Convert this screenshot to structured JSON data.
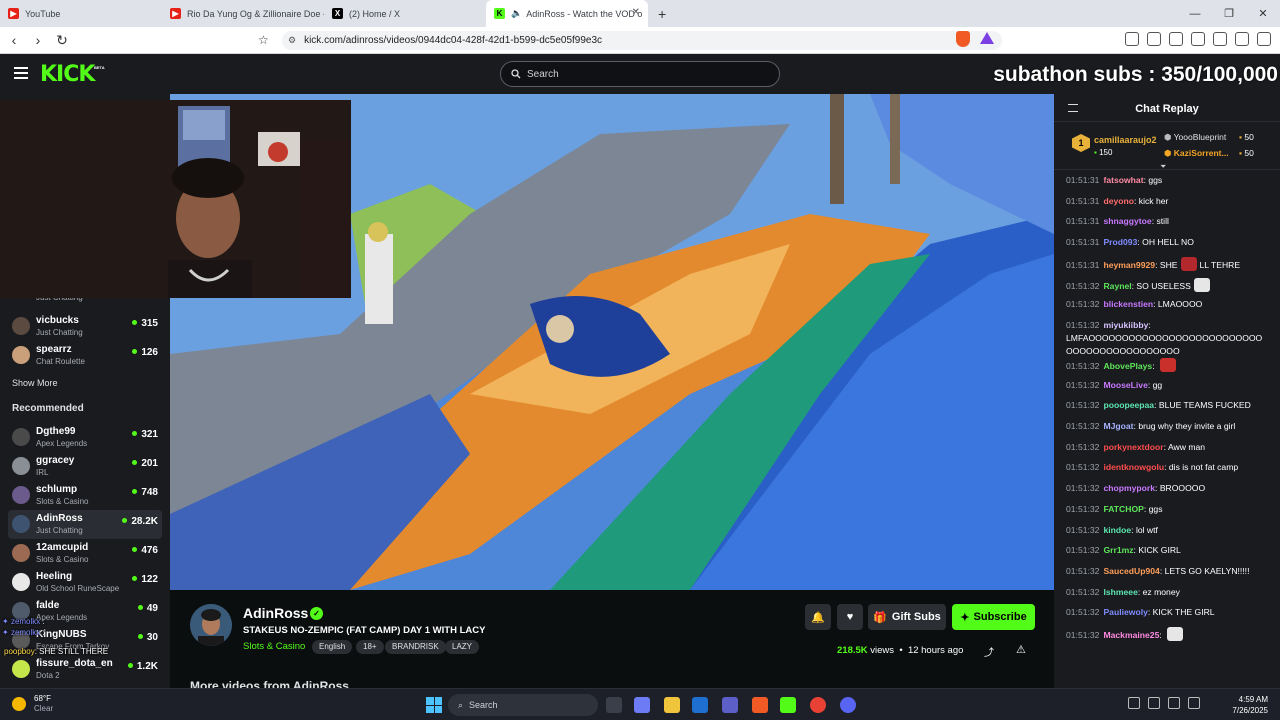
{
  "browser": {
    "tabs": [
      {
        "title": "YouTube",
        "icon": "youtube-icon",
        "color": "#e62117",
        "active": false
      },
      {
        "title": "Rio Da Yung Og & Zillionaire Doe - V",
        "icon": "youtube-icon",
        "color": "#e62117",
        "active": false
      },
      {
        "title": "(2) Home / X",
        "icon": "x-icon",
        "color": "#000000",
        "active": false
      },
      {
        "title": "AdinRoss - Watch the VOD o",
        "icon": "kick-icon",
        "color": "#53fc18",
        "active": true
      }
    ],
    "url": "kick.com/adinross/videos/0944dc04-428f-42d1-b599-dc5e05f99e3c"
  },
  "header": {
    "logo": "KICK",
    "logo_badge": "BETA",
    "search_placeholder": "Search",
    "overlay_banner": "subathon subs : 350/100,000"
  },
  "sidebar": {
    "following_partial_category": "Just Chatting",
    "following": [
      {
        "name": "vicbucks",
        "category": "Just Chatting",
        "viewers": "315",
        "avatar_color": "#5b4a3f"
      },
      {
        "name": "spearrz",
        "category": "Chat Roulette",
        "viewers": "126",
        "avatar_color": "#c9a079"
      }
    ],
    "show_more": "Show More",
    "recommended_title": "Recommended",
    "recommended": [
      {
        "name": "Dgthe99",
        "category": "Apex Legends",
        "viewers": "321",
        "avatar_color": "#4a4a4a",
        "selected": false
      },
      {
        "name": "ggracey",
        "category": "IRL",
        "viewers": "201",
        "avatar_color": "#8a8f96",
        "selected": false
      },
      {
        "name": "schlump",
        "category": "Slots & Casino",
        "viewers": "748",
        "avatar_color": "#6b5a8c",
        "selected": false
      },
      {
        "name": "AdinRoss",
        "category": "Just Chatting",
        "viewers": "28.2K",
        "avatar_color": "#3d5370",
        "selected": true
      },
      {
        "name": "12amcupid",
        "category": "Slots & Casino",
        "viewers": "476",
        "avatar_color": "#9c6a52",
        "selected": false
      },
      {
        "name": "Heeling",
        "category": "Old School RuneScape",
        "viewers": "122",
        "avatar_color": "#e8e8e8",
        "selected": false
      },
      {
        "name": "falde",
        "category": "Apex Legends",
        "viewers": "49",
        "avatar_color": "#4f5a6b",
        "selected": false
      },
      {
        "name": "KingNUBS",
        "category": "Escape From Tarkov",
        "viewers": "30",
        "avatar_color": "#5a5a5a",
        "selected": false
      },
      {
        "name": "fissure_dota_en",
        "category": "Dota 2",
        "viewers": "1.2K",
        "avatar_color": "#c5e64a",
        "selected": false
      }
    ],
    "stream_overlay": {
      "line1_user": "zemolkx",
      "line1_text": ":",
      "line2_user": "zemolkx",
      "line2_text": ":",
      "line3_user": "poopboy",
      "line3_text": ": SHE STILL THERE"
    }
  },
  "video_info": {
    "channel_name": "AdinRoss",
    "stream_title": "STAKEUS NO-ZEMPIC (FAT CAMP) DAY 1 WITH LACY",
    "category": "Slots & Casino",
    "tags": [
      "English",
      "18+",
      "BRANDRISK",
      "LAZY"
    ],
    "gift_subs_label": "Gift Subs",
    "subscribe_label": "Subscribe",
    "views": "218.5K",
    "views_suffix": "views",
    "time_ago": "12 hours ago",
    "more_videos": "More videos from AdinRoss"
  },
  "chat": {
    "title": "Chat Replay",
    "pinned": {
      "rank": "1",
      "user": "camillaaraujo2",
      "user_count": "150",
      "entries": [
        {
          "name": "YoooBlueprint",
          "count": "50",
          "color": "#dfe1e4"
        },
        {
          "name": "KaziSorrent...",
          "count": "50",
          "color": "#f5a623"
        }
      ]
    },
    "messages": [
      {
        "time": "01:51:31",
        "user": "fatsowhat",
        "color": "#ff8aa4",
        "text": "ggs",
        "emote": ""
      },
      {
        "time": "01:51:31",
        "user": "deyono",
        "color": "#ff6b6b",
        "text": "kick her",
        "emote": ""
      },
      {
        "time": "01:51:31",
        "user": "shnaggytoe",
        "color": "#c879ff",
        "text": "still",
        "emote": ""
      },
      {
        "time": "01:51:31",
        "user": "Prod093",
        "color": "#7f8cff",
        "text": "OH HELL NO",
        "emote": ""
      },
      {
        "time": "01:51:31",
        "user": "heyman9929",
        "color": "#ff9e5a",
        "text": "SHE",
        "emote": "#b3282d",
        "text2": "LL TEHRE"
      },
      {
        "time": "01:51:32",
        "user": "Raynel",
        "color": "#5ee65a",
        "text": "SO USELESS",
        "emote": "#e6e6e6"
      },
      {
        "time": "01:51:32",
        "user": "blickenstien",
        "color": "#c879ff",
        "text": "LMAOOOO",
        "emote": ""
      },
      {
        "time": "01:51:32",
        "user": "miyukiibby",
        "color": "#d8c2ff",
        "text": "",
        "emote": ""
      },
      {
        "time": "",
        "user": "",
        "color": "#ffffff",
        "text": "LMFAOOOOOOOOOOOOOOOOOOOOOOOOOO",
        "emote": ""
      },
      {
        "time": "",
        "user": "",
        "color": "#ffffff",
        "text": "OOOOOOOOOOOOOOOOO",
        "emote": ""
      },
      {
        "time": "01:51:32",
        "user": "AbovePlays",
        "color": "#5ee65a",
        "text": "",
        "emote": "#c9302c"
      },
      {
        "time": "01:51:32",
        "user": "MooseLive",
        "color": "#c879ff",
        "text": "gg",
        "emote": ""
      },
      {
        "time": "01:51:32",
        "user": "pooopeepaa",
        "color": "#5ee6b0",
        "text": "BLUE TEAMS FUCKED",
        "emote": ""
      },
      {
        "time": "01:51:32",
        "user": "MJgoat",
        "color": "#a7b3ff",
        "text": "brug why they invite a girl",
        "emote": ""
      },
      {
        "time": "01:51:32",
        "user": "porkynextdoor",
        "color": "#ff4d4d",
        "text": "Aww man",
        "emote": ""
      },
      {
        "time": "01:51:32",
        "user": "identknowgolu",
        "color": "#ff4d4d",
        "text": "dis is not fat camp",
        "emote": ""
      },
      {
        "time": "01:51:32",
        "user": "chopmypork",
        "color": "#c879ff",
        "text": "BROOOOO",
        "emote": ""
      },
      {
        "time": "01:51:32",
        "user": "FATCHOP",
        "color": "#5ee65a",
        "text": "ggs",
        "emote": ""
      },
      {
        "time": "01:51:32",
        "user": "kindoe",
        "color": "#5ee6b0",
        "text": "lol wtf",
        "emote": ""
      },
      {
        "time": "01:51:32",
        "user": "Grr1mz",
        "color": "#5ee65a",
        "text": "KICK GIRL",
        "emote": ""
      },
      {
        "time": "01:51:32",
        "user": "SaucedUp904",
        "color": "#ff9e5a",
        "text": "LETS GO KAELYN!!!!!",
        "emote": ""
      },
      {
        "time": "01:51:32",
        "user": "Ishmeee",
        "color": "#5ee6b0",
        "text": "ez money",
        "emote": ""
      },
      {
        "time": "01:51:32",
        "user": "Pauliewoly",
        "color": "#7f8cff",
        "text": "KICK THE GIRL",
        "emote": ""
      },
      {
        "time": "01:51:32",
        "user": "Mackmaine25",
        "color": "#ff8ae0",
        "text": "",
        "emote": "#e6e6e6"
      }
    ]
  },
  "taskbar": {
    "temperature": "68°F",
    "weather": "Clear",
    "search_placeholder": "Search",
    "time": "4:59 AM",
    "date": "7/26/2025"
  }
}
